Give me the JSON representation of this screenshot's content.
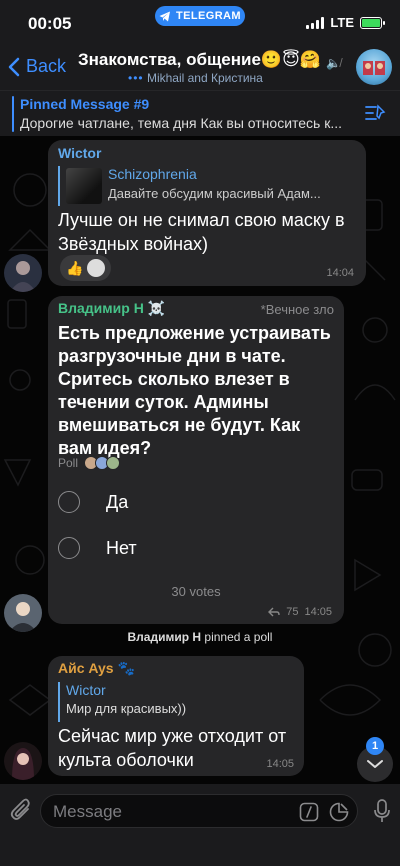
{
  "status_bar": {
    "time": "00:05",
    "app_pill": "TELEGRAM",
    "network": "LTE"
  },
  "header": {
    "back_label": "Back",
    "title": "Знакомства, общение🙂😇🤗",
    "subtitle": "Mikhail and Кристина"
  },
  "pinned": {
    "title": "Pinned Message #9",
    "text": "Дорогие чатлане, тема дня Как вы относитесь к..."
  },
  "messages": [
    {
      "sender": "Wictor",
      "reply_name": "Schizophrenia",
      "reply_text": "Давайте обсудим красивый Адам...",
      "text": "Лучше он не снимал свою маску в Звёздных войнах)",
      "reaction": "👍",
      "time": "14:04"
    },
    {
      "sender": "Владимир Н ☠️",
      "admin_title": "*Вечное зло",
      "question": "Есть предложение устраивать разгрузочные дни в чате. Сритесь сколько влезет в течении суток. Админы вмешиваться не будут. Как вам идея?",
      "poll_label": "Poll",
      "options": [
        "Да",
        "Нет"
      ],
      "votes": "30 votes",
      "replies": "75",
      "time": "14:05"
    },
    {
      "sender": "Айс Ays 🐾",
      "reply_name": "Wictor",
      "reply_text": "Мир для красивых))",
      "text": "Сейчас мир уже отходит от культа оболочки",
      "time": "14:05"
    }
  ],
  "service_message": {
    "actor": "Владимир Н",
    "action": "pinned a poll"
  },
  "unread_count": "1",
  "input": {
    "placeholder": "Message"
  },
  "colors": {
    "accent": "#3e8eff",
    "bubble": "#262628",
    "bar": "#1b1b1d"
  }
}
